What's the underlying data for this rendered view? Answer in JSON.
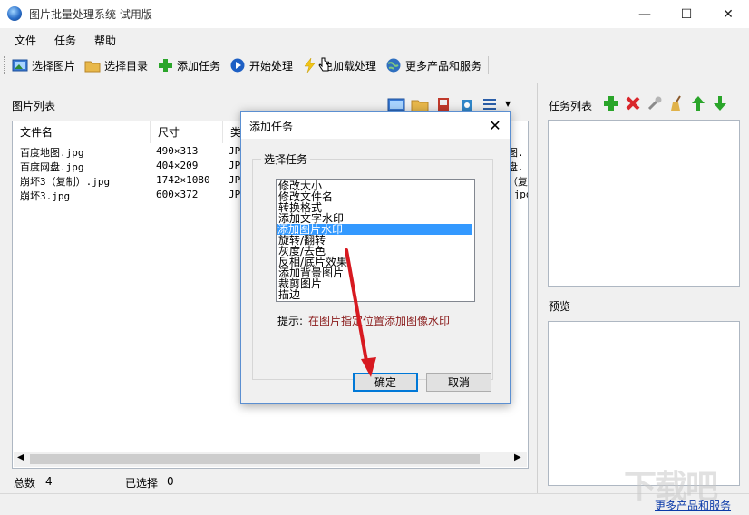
{
  "window": {
    "title": "图片批量处理系统 试用版",
    "controls": {
      "minimize": "—",
      "maximize": "☐",
      "close": "✕"
    }
  },
  "menu": [
    "文件",
    "任务",
    "帮助"
  ],
  "toolbar": [
    {
      "label": "选择图片",
      "icon": "image-icon",
      "color": "#3a7bd5"
    },
    {
      "label": "选择目录",
      "icon": "folder-icon",
      "color": "#e8b84a"
    },
    {
      "label": "添加任务",
      "icon": "plus-icon",
      "color": "#2aa52a"
    },
    {
      "label": "开始处理",
      "icon": "play-icon",
      "color": "#1d5fc4"
    },
    {
      "label": "免加载处理",
      "icon": "lightning-icon",
      "color": "#f0c419"
    },
    {
      "label": "更多产品和服务",
      "icon": "globe-icon",
      "color": "#2f6fbf"
    }
  ],
  "image_list": {
    "label": "图片列表",
    "columns": [
      "文件名",
      "尺寸",
      "类"
    ],
    "rows": [
      {
        "name": "百度地图.jpg",
        "size": "490×313",
        "type": "JP"
      },
      {
        "name": "百度网盘.jpg",
        "size": "404×209",
        "type": "JP"
      },
      {
        "name": "崩坏3（复制）.jpg",
        "size": "1742×1080",
        "type": "JP"
      },
      {
        "name": "崩坏3.jpg",
        "size": "600×372",
        "type": "JP"
      }
    ],
    "right_fragments": [
      "图.",
      "盘.",
      "（复",
      ".jpg"
    ]
  },
  "status": {
    "total_label": "总数",
    "total_value": "4",
    "selected_label": "已选择",
    "selected_value": "0"
  },
  "task_panel": {
    "label": "任务列表"
  },
  "preview_panel": {
    "label": "预览"
  },
  "more_link": "更多产品和服务",
  "watermark": "下载吧",
  "dialog": {
    "title": "添加任务",
    "group_label": "选择任务",
    "tasks": [
      "修改大小",
      "修改文件名",
      "转换格式",
      "添加文字水印",
      "添加图片水印",
      "旋转/翻转",
      "灰度/去色",
      "反相/底片效果",
      "添加背景图片",
      "裁剪图片",
      "描边"
    ],
    "selected_index": 4,
    "hint_label": "提示:",
    "hint_text": "在图片指定位置添加图像水印",
    "ok": "确定",
    "cancel": "取消"
  },
  "colors": {
    "accent": "#0078d7",
    "arrow": "#d71920",
    "selection": "#3399ff"
  }
}
